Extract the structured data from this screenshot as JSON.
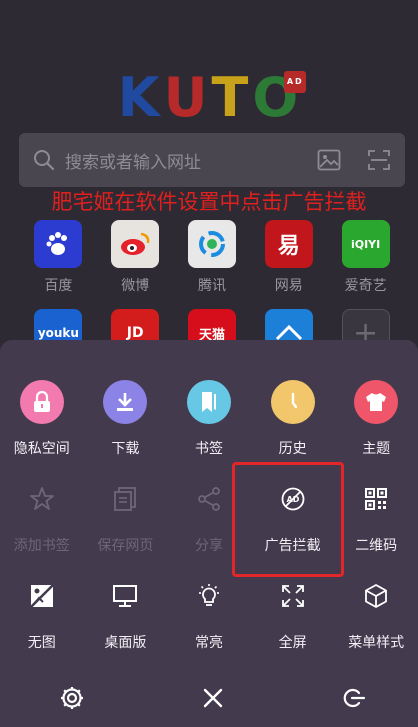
{
  "background": {
    "logo": {
      "letters": [
        "K",
        "U",
        "T",
        "O"
      ],
      "badge": "AD"
    },
    "search": {
      "placeholder": "搜索或者输入网址"
    },
    "overlay_note": "肥宅姬在软件设置中点击广告拦截",
    "sites": [
      {
        "label": "百度",
        "tile_text": "",
        "color": "#2d3cd0",
        "icon": "baidu-paw-icon"
      },
      {
        "label": "微博",
        "tile_text": "",
        "color": "#e7e4e0",
        "icon": "weibo-icon"
      },
      {
        "label": "腾讯",
        "tile_text": "",
        "color": "#e8e8e8",
        "icon": "tencent-icon"
      },
      {
        "label": "网易",
        "tile_text": "易",
        "color": "#c0161c",
        "icon": "netease-icon"
      },
      {
        "label": "爱奇艺",
        "tile_text": "iQIYI",
        "color": "#2aa72e",
        "icon": "iqiyi-icon"
      },
      {
        "label": "",
        "tile_text": "youku",
        "color": "#1a62cf",
        "icon": "youku-icon"
      },
      {
        "label": "",
        "tile_text": "JD",
        "color": "#d31c1c",
        "icon": "jd-icon"
      },
      {
        "label": "",
        "tile_text": "天猫",
        "color": "#d60d1a",
        "icon": "tmall-icon"
      },
      {
        "label": "",
        "tile_text": "",
        "color": "#1c7fd8",
        "icon": "ctrip-icon"
      },
      {
        "label": "",
        "tile_text": "+",
        "color": "#3a3640",
        "icon": "add-site-icon"
      }
    ]
  },
  "menu": {
    "items": [
      {
        "label": "隐私空间",
        "icon": "lock-icon",
        "color": "#f37aae",
        "disabled": false
      },
      {
        "label": "下载",
        "icon": "download-icon",
        "color": "#8c83e6",
        "disabled": false
      },
      {
        "label": "书签",
        "icon": "bookmark-icon",
        "color": "#67c8e6",
        "disabled": false
      },
      {
        "label": "历史",
        "icon": "clock-icon",
        "color": "#f2c66b",
        "disabled": false
      },
      {
        "label": "主题",
        "icon": "tshirt-icon",
        "color": "#f0566a",
        "disabled": false
      },
      {
        "label": "添加书签",
        "icon": "star-icon",
        "color": "",
        "disabled": true
      },
      {
        "label": "保存网页",
        "icon": "save-page-icon",
        "color": "",
        "disabled": true
      },
      {
        "label": "分享",
        "icon": "share-icon",
        "color": "",
        "disabled": true
      },
      {
        "label": "广告拦截",
        "icon": "ad-block-icon",
        "color": "",
        "disabled": false
      },
      {
        "label": "二维码",
        "icon": "qr-code-icon",
        "color": "",
        "disabled": false
      },
      {
        "label": "无图",
        "icon": "no-image-icon",
        "color": "",
        "disabled": false
      },
      {
        "label": "桌面版",
        "icon": "desktop-icon",
        "color": "",
        "disabled": false
      },
      {
        "label": "常亮",
        "icon": "bulb-icon",
        "color": "",
        "disabled": false
      },
      {
        "label": "全屏",
        "icon": "fullscreen-icon",
        "color": "",
        "disabled": false
      },
      {
        "label": "菜单样式",
        "icon": "cube-icon",
        "color": "",
        "disabled": false
      }
    ],
    "bottom": [
      "settings-gear-icon",
      "close-icon",
      "exit-icon"
    ],
    "highlight_color": "#e3262a"
  }
}
